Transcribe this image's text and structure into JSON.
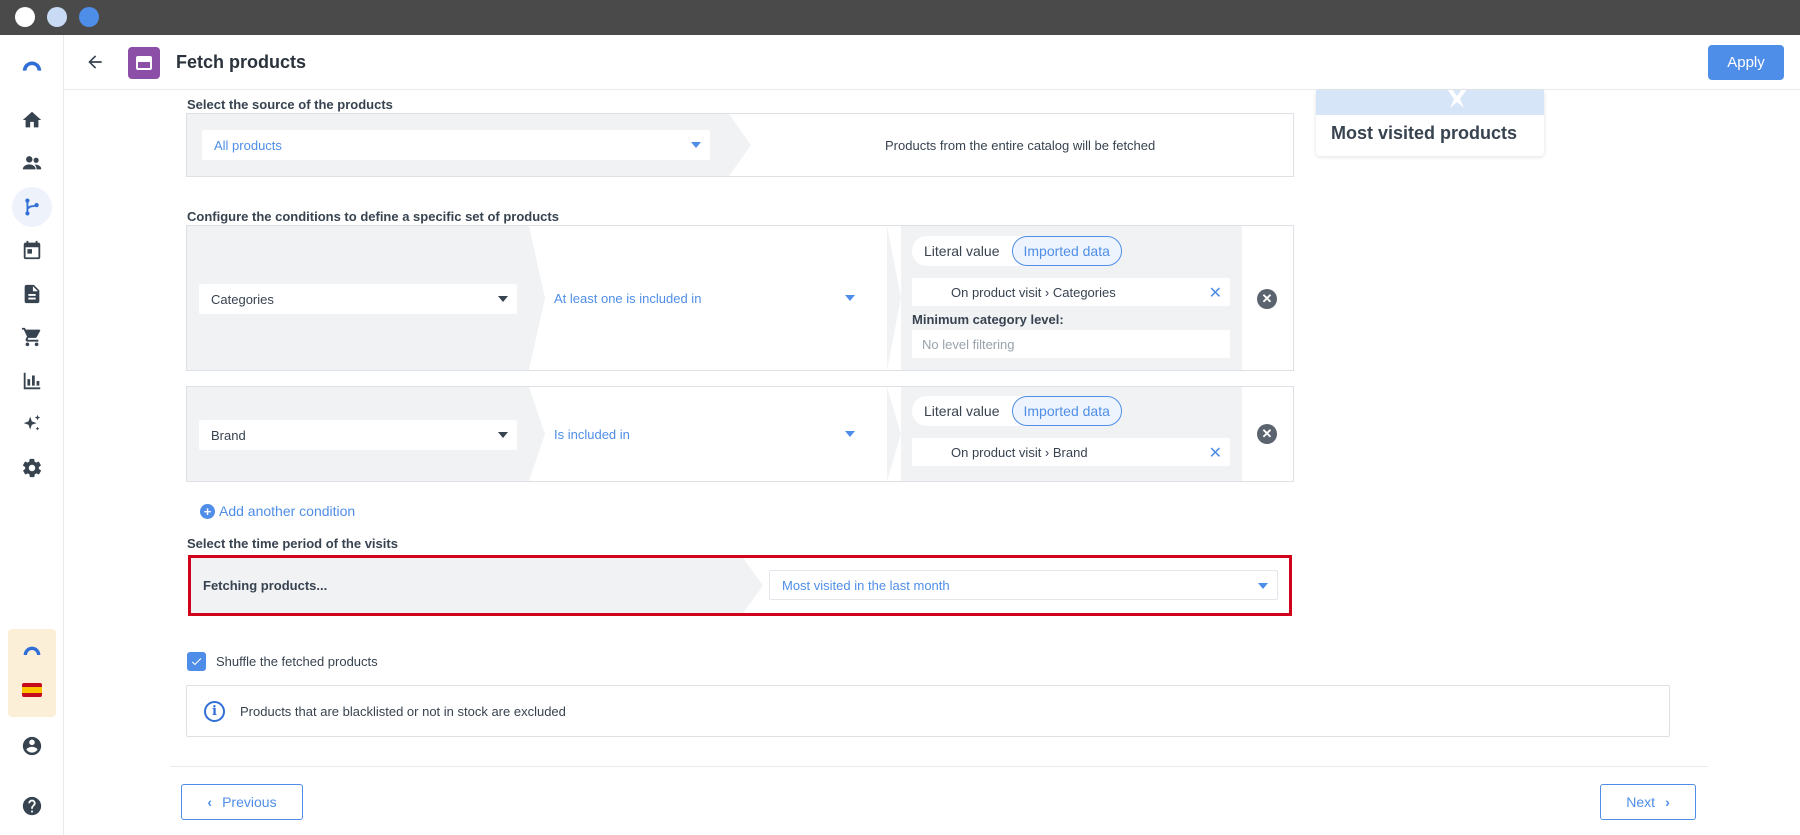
{
  "window": {
    "dots": [
      "#ffffff",
      "#c9daf5",
      "#4f8ee8"
    ]
  },
  "header": {
    "title": "Fetch products",
    "apply_label": "Apply"
  },
  "sidebar": {
    "items": [
      "logo-icon",
      "home-icon",
      "people-icon",
      "flow-icon",
      "calendar-icon",
      "document-icon",
      "cart-icon",
      "chart-icon",
      "sparkle-icon",
      "settings-icon"
    ],
    "active": "flow-icon",
    "flag": "es"
  },
  "preview": {
    "label": "Most visited products"
  },
  "source": {
    "heading": "Select the source of the products",
    "selected": "All products",
    "description": "Products from the entire catalog will be fetched"
  },
  "conditions": {
    "heading": "Configure the conditions to define a specific set of products",
    "items": [
      {
        "field": "Categories",
        "operator": "At least one is included in",
        "toggle_literal": "Literal value",
        "toggle_imported": "Imported data",
        "value": "On product visit › Categories",
        "min_level_label": "Minimum category level:",
        "min_level_placeholder": "No level filtering"
      },
      {
        "field": "Brand",
        "operator": "Is included in",
        "toggle_literal": "Literal value",
        "toggle_imported": "Imported data",
        "value": "On product visit › Brand"
      }
    ],
    "add_label": "Add another condition"
  },
  "period": {
    "heading": "Select the time period of the visits",
    "prefix": "Fetching products...",
    "selected": "Most visited in the last month"
  },
  "shuffle": {
    "label": "Shuffle the fetched products",
    "checked": true
  },
  "info": {
    "text": "Products that are blacklisted or not in stock are excluded"
  },
  "footer": {
    "previous_label": "Previous",
    "next_label": "Next"
  },
  "colors": {
    "accent": "#4f8ee8",
    "highlight": "#d0021b",
    "purple": "#8b4fa8"
  }
}
